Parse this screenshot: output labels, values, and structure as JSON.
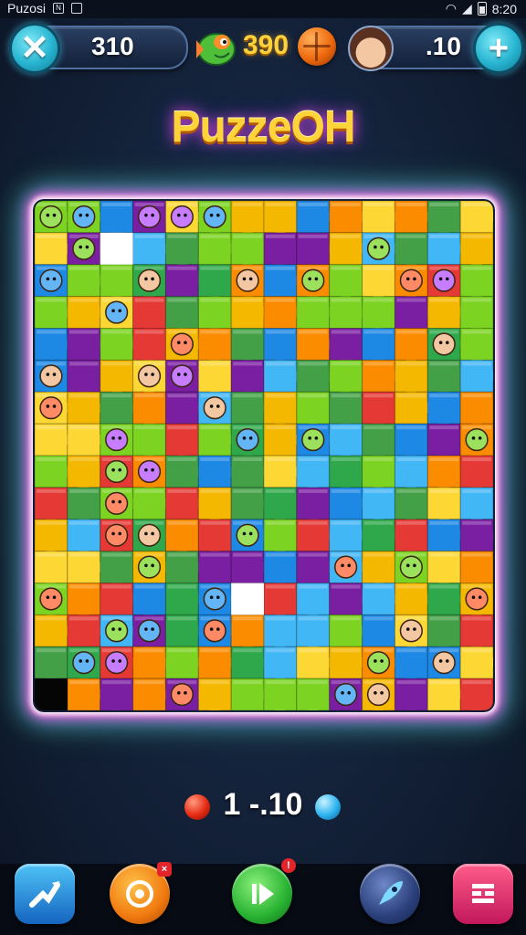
{
  "status_bar": {
    "app_name": "Puzosi",
    "time": "8:20"
  },
  "hud": {
    "left_counter": "310",
    "coins": "390",
    "right_counter": ".10",
    "close_symbol": "✕",
    "add_symbol": "+"
  },
  "title": "PuzzeOH",
  "hint": {
    "text": "1 -.10"
  },
  "board": {
    "cols": 14,
    "rows": 16,
    "palette": [
      "#e53935",
      "#fb8c00",
      "#fdd835",
      "#43a047",
      "#7cd321",
      "#1e88e5",
      "#42b7f5",
      "#7b1fa2",
      "#2ea84a",
      "#f5b800"
    ]
  },
  "icons": {
    "close": "close-icon",
    "add": "plus-icon",
    "fish_avatar": "fish-avatar",
    "coin": "basketball-coin-icon",
    "girl_avatar": "girl-avatar",
    "bottom": [
      "shuffle-icon",
      "target-icon",
      "play-icon",
      "rocket-icon",
      "cart-icon"
    ]
  },
  "badges": {
    "target": "×",
    "play": "!"
  }
}
